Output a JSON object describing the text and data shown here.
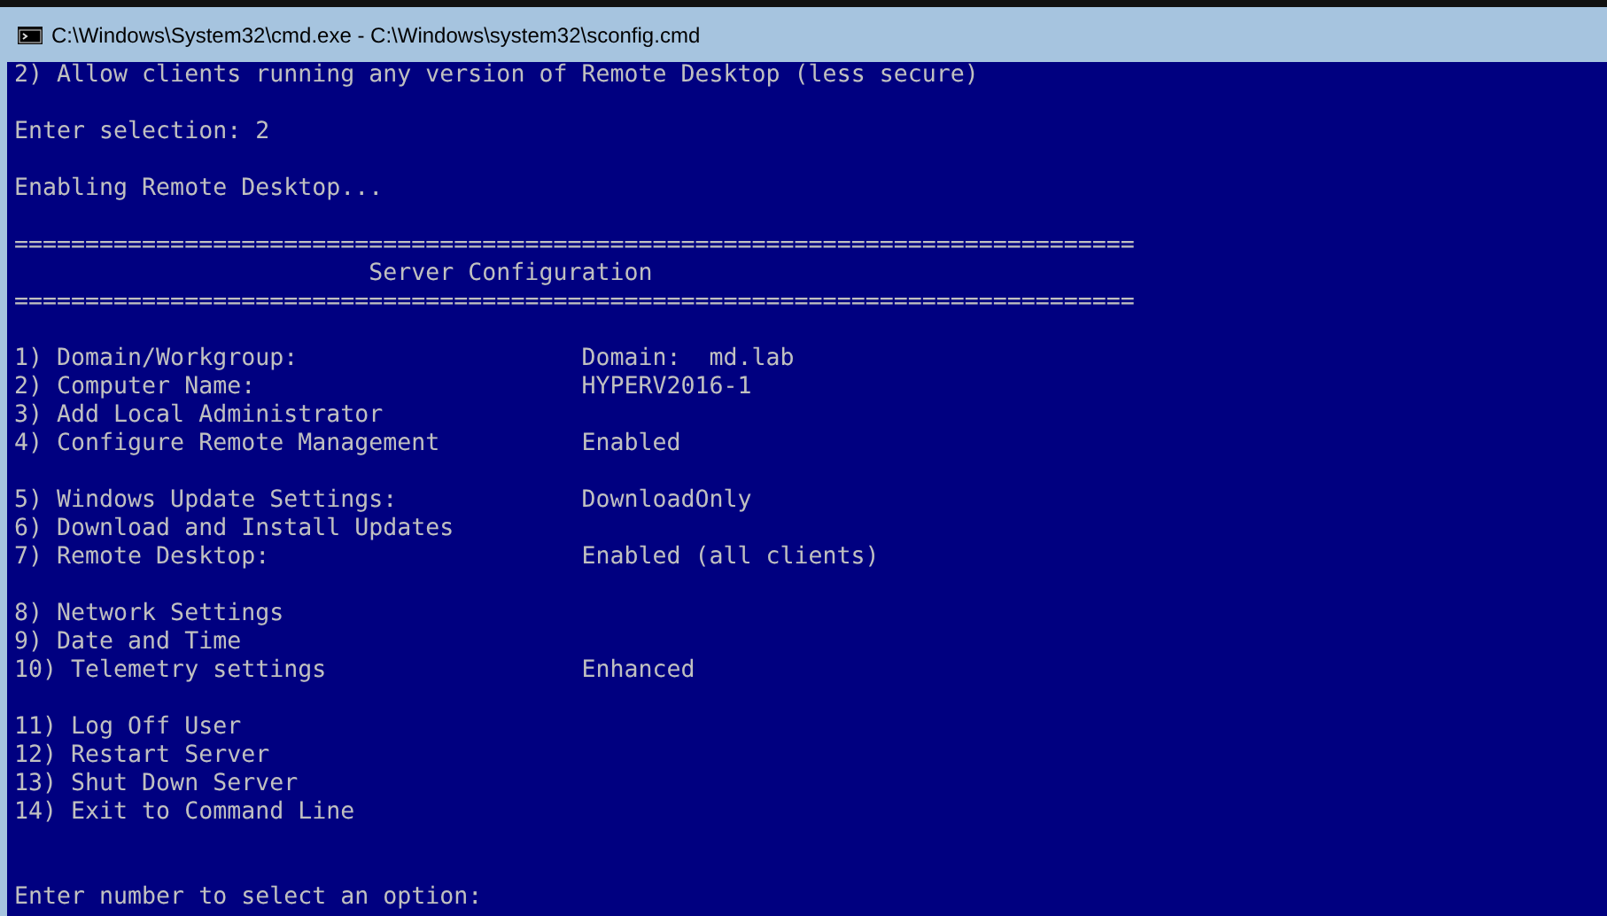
{
  "window": {
    "title": "C:\\Windows\\System32\\cmd.exe - C:\\Windows\\system32\\sconfig.cmd"
  },
  "console": {
    "lines": [
      {
        "kind": "text",
        "text": "2) Allow clients running any version of Remote Desktop (less secure)"
      },
      {
        "kind": "blank"
      },
      {
        "kind": "text",
        "text": "Enter selection: 2"
      },
      {
        "kind": "blank"
      },
      {
        "kind": "text",
        "text": "Enabling Remote Desktop..."
      },
      {
        "kind": "blank"
      },
      {
        "kind": "rule",
        "text": "==============================================================================="
      },
      {
        "kind": "heading",
        "text": "Server Configuration"
      },
      {
        "kind": "rule",
        "text": "==============================================================================="
      },
      {
        "kind": "blank"
      },
      {
        "kind": "option",
        "label": "1) Domain/Workgroup:",
        "value": "Domain:  md.lab"
      },
      {
        "kind": "option",
        "label": "2) Computer Name:",
        "value": "HYPERV2016-1"
      },
      {
        "kind": "option",
        "label": "3) Add Local Administrator"
      },
      {
        "kind": "option",
        "label": "4) Configure Remote Management",
        "value": "Enabled"
      },
      {
        "kind": "blank"
      },
      {
        "kind": "option",
        "label": "5) Windows Update Settings:",
        "value": "DownloadOnly"
      },
      {
        "kind": "option",
        "label": "6) Download and Install Updates"
      },
      {
        "kind": "option",
        "label": "7) Remote Desktop:",
        "value": "Enabled (all clients)"
      },
      {
        "kind": "blank"
      },
      {
        "kind": "option",
        "label": "8) Network Settings"
      },
      {
        "kind": "option",
        "label": "9) Date and Time"
      },
      {
        "kind": "option",
        "label": "10) Telemetry settings",
        "value": "Enhanced"
      },
      {
        "kind": "blank"
      },
      {
        "kind": "option",
        "label": "11) Log Off User"
      },
      {
        "kind": "option",
        "label": "12) Restart Server"
      },
      {
        "kind": "option",
        "label": "13) Shut Down Server"
      },
      {
        "kind": "option",
        "label": "14) Exit to Command Line"
      },
      {
        "kind": "blank"
      },
      {
        "kind": "blank"
      },
      {
        "kind": "prompt",
        "text": "Enter number to select an option:"
      }
    ]
  }
}
